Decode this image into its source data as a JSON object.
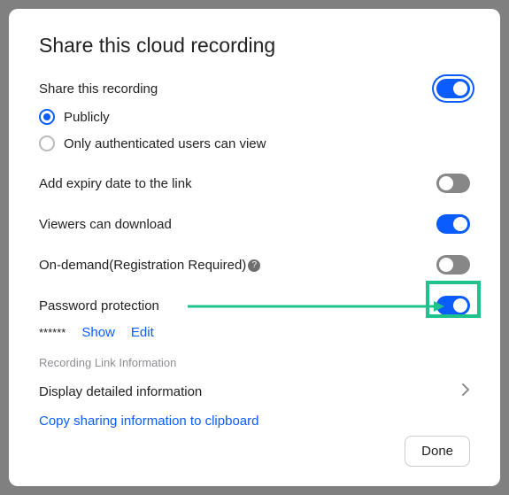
{
  "title": "Share this cloud recording",
  "share": {
    "label": "Share this recording",
    "on": true,
    "radios": {
      "public": "Publicly",
      "auth": "Only authenticated users can view"
    }
  },
  "expiry": {
    "label": "Add expiry date to the link",
    "on": false
  },
  "download": {
    "label": "Viewers can download",
    "on": true
  },
  "ondemand": {
    "label": "On-demand(Registration Required)",
    "on": false
  },
  "password": {
    "label": "Password protection",
    "on": true,
    "mask": "******",
    "show": "Show",
    "edit": "Edit"
  },
  "linkinfo": {
    "section": "Recording Link Information",
    "detail": "Display detailed information",
    "copy": "Copy sharing information to clipboard"
  },
  "done": "Done"
}
